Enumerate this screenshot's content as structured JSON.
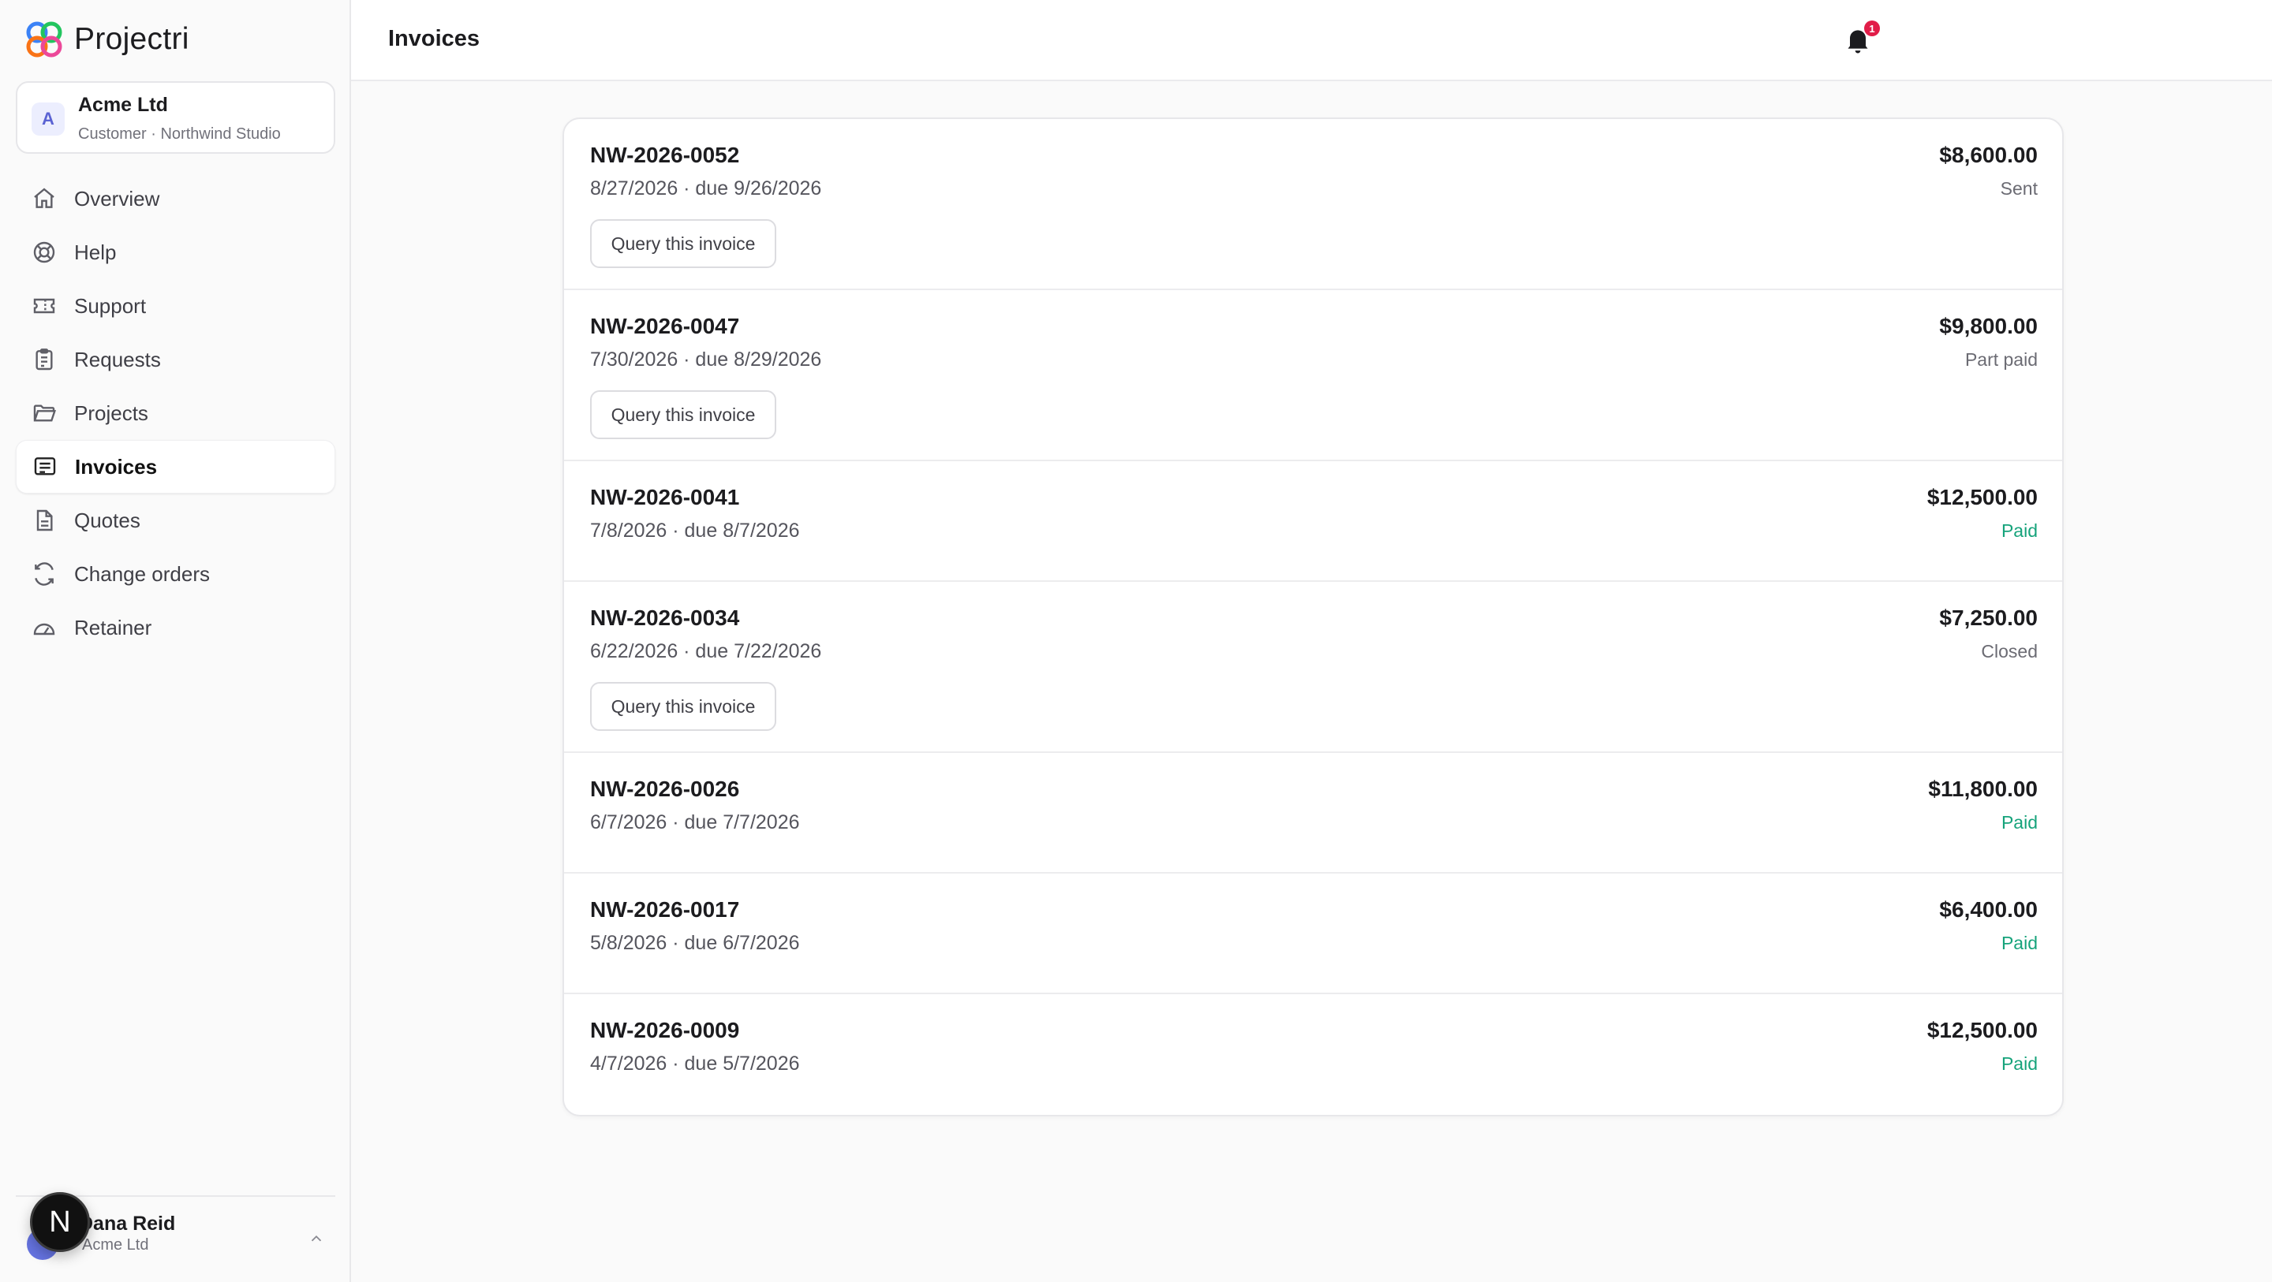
{
  "app": {
    "name": "Projectri"
  },
  "org": {
    "initial": "A",
    "name": "Acme Ltd",
    "subtitle": "Customer · Northwind Studio"
  },
  "nav": [
    {
      "label": "Overview",
      "icon": "home-icon",
      "active": false
    },
    {
      "label": "Help",
      "icon": "lifebuoy-icon",
      "active": false
    },
    {
      "label": "Support",
      "icon": "ticket-icon",
      "active": false
    },
    {
      "label": "Requests",
      "icon": "clipboard-icon",
      "active": false
    },
    {
      "label": "Projects",
      "icon": "folder-icon",
      "active": false
    },
    {
      "label": "Invoices",
      "icon": "receipt-icon",
      "active": true
    },
    {
      "label": "Quotes",
      "icon": "document-icon",
      "active": false
    },
    {
      "label": "Change orders",
      "icon": "refresh-icon",
      "active": false
    },
    {
      "label": "Retainer",
      "icon": "gauge-icon",
      "active": false
    }
  ],
  "user": {
    "name": "Dana Reid",
    "org": "Acme Ltd"
  },
  "dev_badge": "N",
  "header": {
    "title": "Invoices",
    "notification_count": "1"
  },
  "query_label": "Query this invoice",
  "status_colors": {
    "Paid": "#16a37b",
    "Sent": "#6b6b73",
    "Part paid": "#6b6b73",
    "Closed": "#6b6b73"
  },
  "invoices": [
    {
      "number": "NW-2026-0052",
      "dates": "8/27/2026 · due 9/26/2026",
      "amount": "$8,600.00",
      "status": "Sent",
      "queryable": true
    },
    {
      "number": "NW-2026-0047",
      "dates": "7/30/2026 · due 8/29/2026",
      "amount": "$9,800.00",
      "status": "Part paid",
      "queryable": true
    },
    {
      "number": "NW-2026-0041",
      "dates": "7/8/2026 · due 8/7/2026",
      "amount": "$12,500.00",
      "status": "Paid",
      "queryable": false
    },
    {
      "number": "NW-2026-0034",
      "dates": "6/22/2026 · due 7/22/2026",
      "amount": "$7,250.00",
      "status": "Closed",
      "queryable": true
    },
    {
      "number": "NW-2026-0026",
      "dates": "6/7/2026 · due 7/7/2026",
      "amount": "$11,800.00",
      "status": "Paid",
      "queryable": false
    },
    {
      "number": "NW-2026-0017",
      "dates": "5/8/2026 · due 6/7/2026",
      "amount": "$6,400.00",
      "status": "Paid",
      "queryable": false
    },
    {
      "number": "NW-2026-0009",
      "dates": "4/7/2026 · due 5/7/2026",
      "amount": "$12,500.00",
      "status": "Paid",
      "queryable": false
    }
  ]
}
